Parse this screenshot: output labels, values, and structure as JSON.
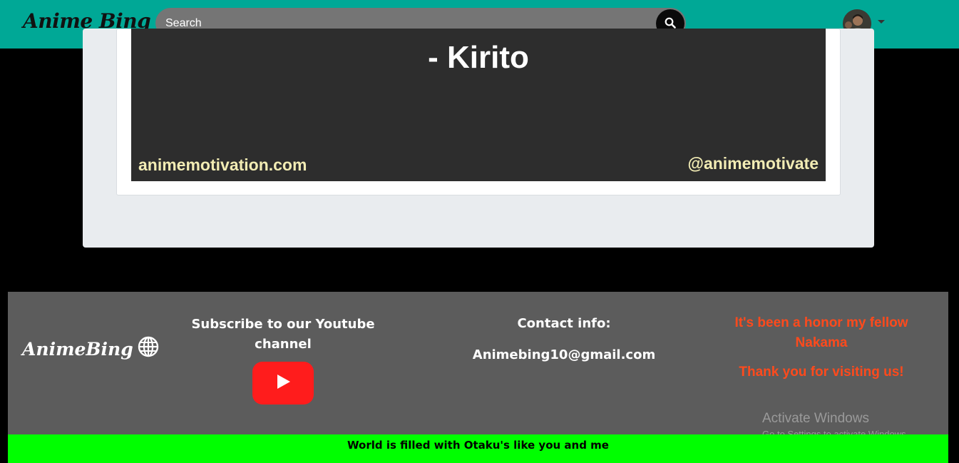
{
  "navbar": {
    "brand": "Anime Bing",
    "search_placeholder": "Search",
    "search_icon": "search-icon",
    "avatar_caret_icon": "caret-down-icon"
  },
  "quote_image": {
    "author": "- Kirito",
    "watermark_left": "animemotivation.com",
    "watermark_right": "@animemotivate"
  },
  "footer": {
    "logo_text": "AnimeBing",
    "logo_icon": "globe-icon",
    "youtube_heading": "Subscribe to our Youtube channel",
    "youtube_icon": "youtube-play-icon",
    "contact_heading": "Contact info:",
    "contact_email": "Animebing10@gmail.com",
    "farewell": "It's been a honor my fellow Nakama",
    "thanks": "Thank you for visiting us!",
    "bottom_text": "World is filled with Otaku's like you and me"
  },
  "windows_watermark": {
    "title": "Activate Windows",
    "subtitle": "Go to Settings to activate Windows."
  },
  "colors": {
    "navbar": "#00a896",
    "footer": "#5c5c5c",
    "bottom_bar": "#00ff00",
    "accent_red": "#ff4a1c",
    "youtube_red": "#ff1c1c"
  }
}
